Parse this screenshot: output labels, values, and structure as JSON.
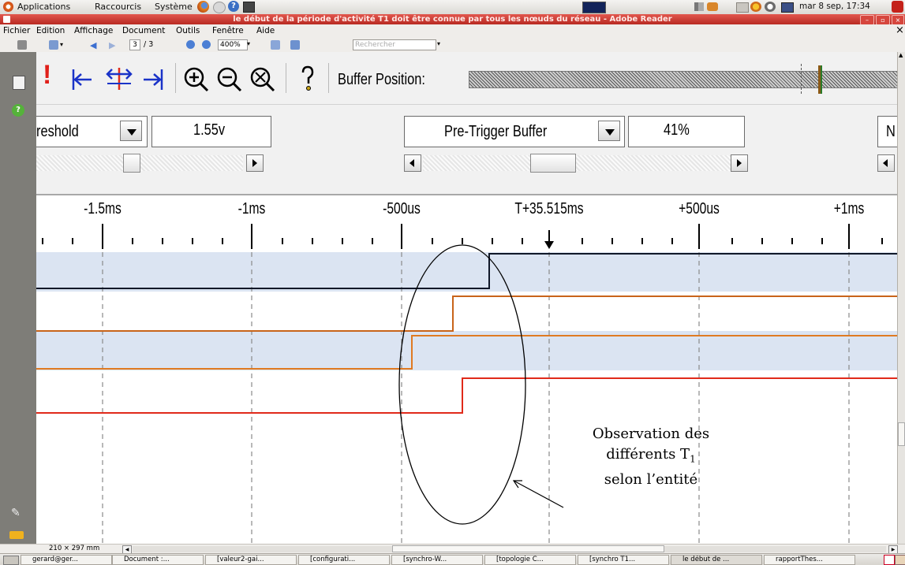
{
  "gnome_panel": {
    "menus": [
      "Applications",
      "Raccourcis",
      "Système"
    ],
    "clock": "mar 8 sep, 17:34"
  },
  "window": {
    "title": "le début de la période d'activité T1 doit être connue par tous les nœuds du réseau - Adobe Reader"
  },
  "menubar": {
    "items": [
      "Fichier",
      "Edition",
      "Affichage",
      "Document",
      "Outils",
      "Fenêtre",
      "Aide"
    ],
    "close": "×"
  },
  "toolbar": {
    "page_current": "3",
    "page_total": "/ 3",
    "zoom": "400%",
    "search_placeholder": "Rechercher"
  },
  "analyzer": {
    "buffer_position_label": "Buffer Position:",
    "threshold_label": "reshold",
    "threshold_value": "1.55v",
    "pretrigger_label": "Pre-Trigger Buffer",
    "pretrigger_value": "41%",
    "cut_label": "N",
    "time_ticks": [
      "-1.5ms",
      "-1ms",
      "-500us",
      "T+35.515ms",
      "+500us",
      "+1ms"
    ],
    "row_colors": [
      "#dbe4f2",
      "#ffffff",
      "#dbe4f2",
      "#ffffff"
    ],
    "signal_colors": [
      "#101828",
      "#c8641a",
      "#e07a22",
      "#e02a1a"
    ]
  },
  "annotation": {
    "line1": "Observation des",
    "line2": "différents T",
    "subscript": "1",
    "line3": "selon l’entité"
  },
  "statusbar": {
    "page_size": "210 × 297 mm"
  },
  "taskbar": {
    "tasks": [
      "gerard@ger...",
      "Document :...",
      "[valeur2-gai...",
      "[configurati...",
      "[synchro-W...",
      "[topologie C...",
      "[synchro T1...",
      "le début de ...",
      "rapportThes..."
    ]
  }
}
